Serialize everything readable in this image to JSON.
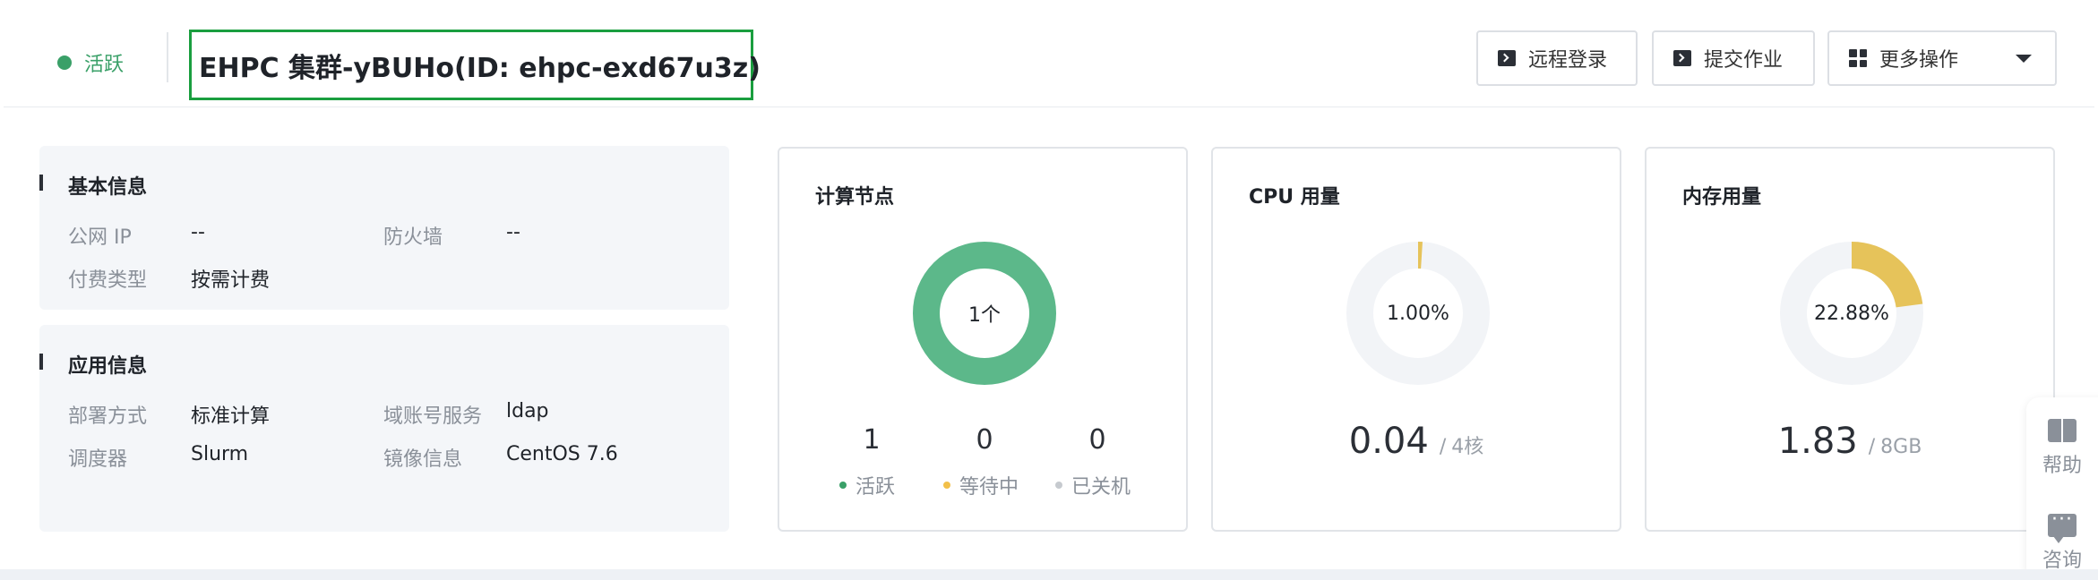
{
  "header": {
    "status": "活跃",
    "title": "EHPC 集群-yBUHo(ID: ehpc-exd67u3z)",
    "buttons": {
      "remote_login": "远程登录",
      "submit_job": "提交作业",
      "more_actions": "更多操作"
    }
  },
  "basic_info": {
    "heading": "基本信息",
    "public_ip_label": "公网 IP",
    "public_ip_value": "--",
    "firewall_label": "防火墙",
    "firewall_value": "--",
    "billing_label": "付费类型",
    "billing_value": "按需计费"
  },
  "app_info": {
    "heading": "应用信息",
    "deploy_label": "部署方式",
    "deploy_value": "标准计算",
    "domain_label": "域账号服务",
    "domain_value": "ldap",
    "scheduler_label": "调度器",
    "scheduler_value": "Slurm",
    "image_label": "镜像信息",
    "image_value": "CentOS 7.6"
  },
  "compute_nodes": {
    "title": "计算节点",
    "center_label": "1个",
    "active_count": "1",
    "waiting_count": "0",
    "shutdown_count": "0",
    "active_label": "活跃",
    "waiting_label": "等待中",
    "shutdown_label": "已关机"
  },
  "cpu": {
    "title": "CPU 用量",
    "percent_label": "1.00%",
    "percent": 1.0,
    "used": "0.04",
    "total": "4核"
  },
  "memory": {
    "title": "内存用量",
    "percent_label": "22.88%",
    "percent": 22.88,
    "used": "1.83",
    "total": "8GB"
  },
  "side": {
    "help": "帮助",
    "consult": "咨询"
  },
  "colors": {
    "active": "#3aa068",
    "node_ring": "#5cb88a",
    "waiting": "#f2c04a",
    "shutdown": "#c6cacf",
    "usage": "#e6c35a",
    "track": "#f2f4f7"
  }
}
